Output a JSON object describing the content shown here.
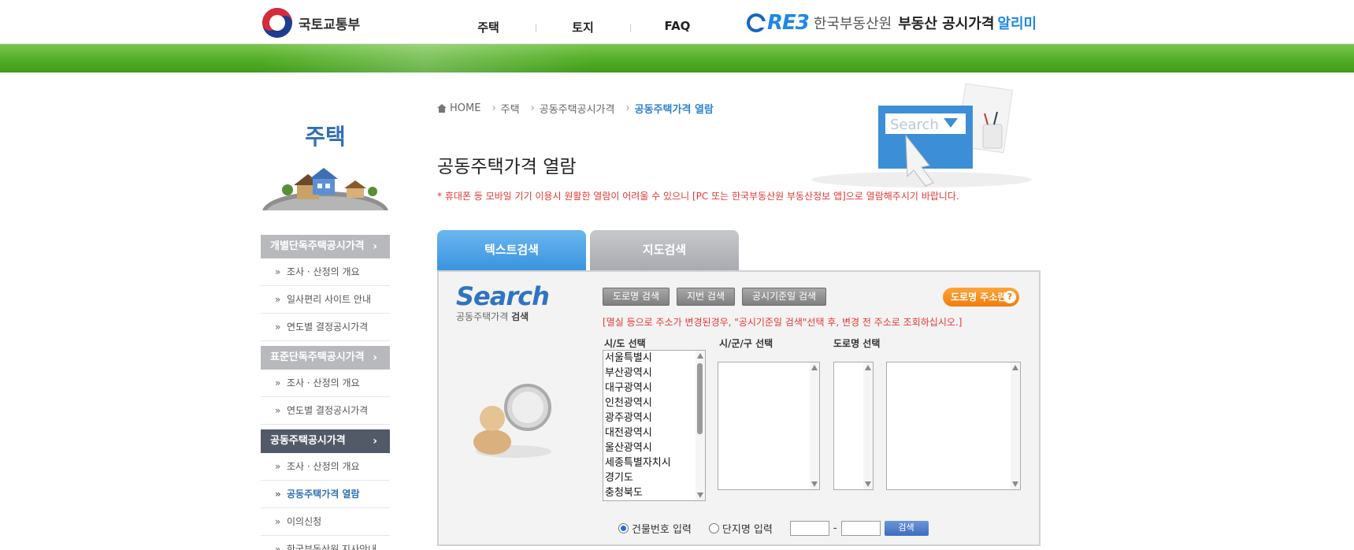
{
  "header": {
    "ministry": "국토교통부",
    "nav": [
      "주택",
      "토지",
      "FAQ"
    ],
    "reb_letters": "RE3",
    "reb_org": "한국부동산원",
    "reb_service": "부동산 공시가격",
    "reb_service_accent": "알리미"
  },
  "sidebar": {
    "title": "주택",
    "groups": [
      {
        "label": "개별단독주택공시가격",
        "items": [
          "조사 · 산정의 개요",
          "일사편리 사이트 안내",
          "연도별 결정공시가격"
        ]
      },
      {
        "label": "표준단독주택공시가격",
        "items": [
          "조사 · 산정의 개요",
          "연도별 결정공시가격"
        ]
      },
      {
        "label": "공동주택공시가격",
        "items": [
          "조사 · 산정의 개요",
          "공동주택가격 열람",
          "이의신청",
          "한국부동산원 지사안내"
        ]
      }
    ]
  },
  "breadcrumb": {
    "home": "HOME",
    "b1": "주택",
    "b2": "공동주택공시가격",
    "current": "공동주택가격 열람"
  },
  "hero_search": "Search",
  "page": {
    "title": "공동주택가격 열람",
    "notice": "* 휴대폰 등 모바일 기기 이용시 원활한 열람이 어려울 수 있으니 [PC 또는 한국부동산원 부동산정보 앱]으로 열람해주시기 바랍니다."
  },
  "tabs": {
    "text": "텍스트검색",
    "map": "지도검색"
  },
  "search": {
    "logo": "Search",
    "sub_prefix": "공동주택가격",
    "sub_bold": "검색",
    "buttons": [
      "도로명 검색",
      "지번 검색",
      "공시기준일 검색"
    ],
    "road_address_btn": "도로명 주소란",
    "help_glyph": "?",
    "hint": "[멸실 등으로 주소가 변경된경우, \"공시기준일 검색\"선택 후, 변경 전 주소로 조회하십시오.]",
    "labels": {
      "sido": "시/도 선택",
      "sigungu": "시/군/구 선택",
      "road": "도로명 선택"
    },
    "sido_options": [
      "서울특별시",
      "부산광역시",
      "대구광역시",
      "인천광역시",
      "광주광역시",
      "대전광역시",
      "울산광역시",
      "세종특별자치시",
      "경기도",
      "충청북도"
    ],
    "radio_building": "건물번호 입력",
    "radio_complex": "단지명 입력",
    "dash": "-",
    "search_btn": "검색"
  },
  "colors": {
    "green": "#58b22c",
    "accent_blue": "#2f82d0",
    "notice_red": "#e53935",
    "orange": "#f07b0a"
  }
}
